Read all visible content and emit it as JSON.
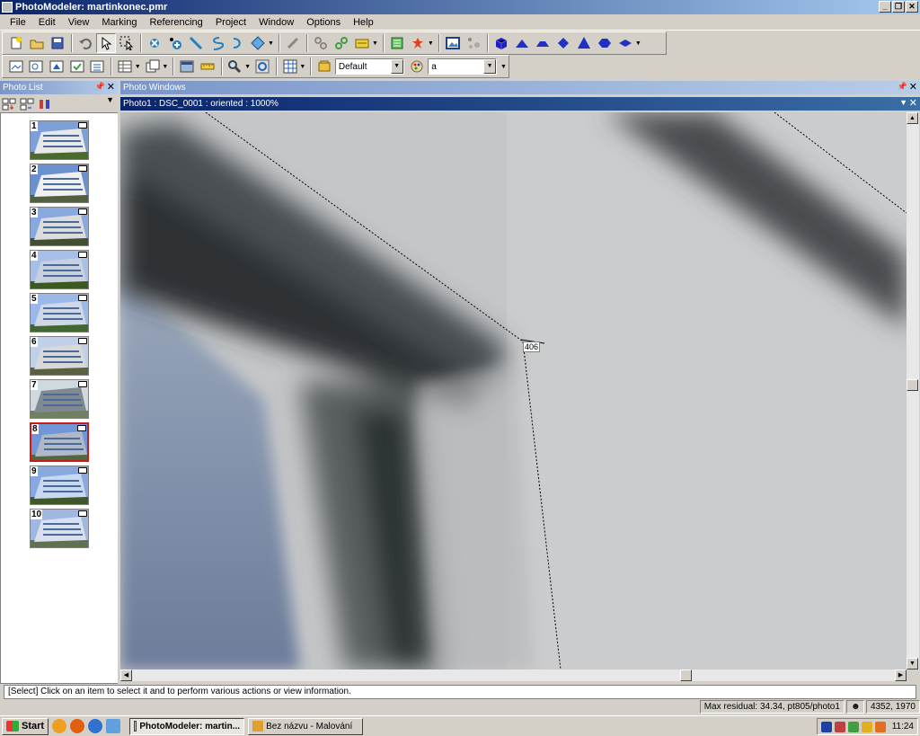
{
  "window": {
    "title": "PhotoModeler: martinkonec.pmr"
  },
  "menu": [
    "File",
    "Edit",
    "View",
    "Marking",
    "Referencing",
    "Project",
    "Window",
    "Options",
    "Help"
  ],
  "toolbar": {
    "combo1_value": "Default",
    "combo2_value": "a"
  },
  "photo_list": {
    "title": "Photo List",
    "photos": [
      "1",
      "2",
      "3",
      "4",
      "5",
      "6",
      "7",
      "8",
      "9",
      "10"
    ],
    "selected": "8"
  },
  "photo_windows": {
    "title": "Photo Windows"
  },
  "photo_view": {
    "title": "Photo1 : DSC_0001 : oriented : 1000%",
    "point_label": "406"
  },
  "info_text": "[Select] Click on an item to select it and to perform various actions or view information.",
  "status": {
    "residual": "Max residual: 34.34, pt805/photo1",
    "coords": "4352, 1970"
  },
  "taskbar": {
    "start_label": "Start",
    "tasks": [
      "PhotoModeler: martin...",
      "Bez názvu - Malování"
    ],
    "clock": "11:24"
  }
}
